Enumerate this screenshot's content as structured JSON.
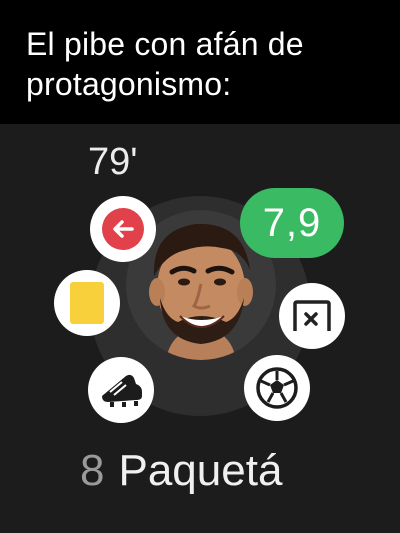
{
  "caption": {
    "text": "El pibe con afán de protagonismo:"
  },
  "player_card": {
    "minute": "79'",
    "rating": "7,9",
    "shirt_number": "8",
    "player_name": "Paquetá",
    "colors": {
      "rating_badge": "#3aba63",
      "substitution": "#e0414a",
      "yellow_card": "#f7d03c",
      "background": "#1c1c1c"
    },
    "icons": [
      "substitution-off-icon",
      "yellow-card-icon",
      "boot-icon",
      "save-icon",
      "football-icon"
    ]
  }
}
